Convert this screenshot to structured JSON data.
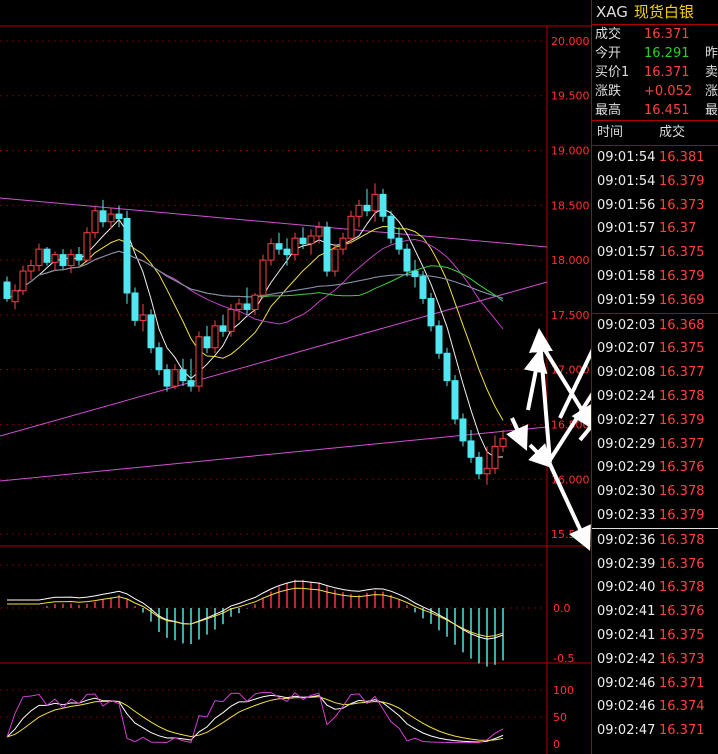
{
  "header": {
    "symbol": "XAG",
    "name": "现货白银"
  },
  "quote": [
    {
      "label": "成交",
      "value": "16.371",
      "color": "red",
      "extra": ""
    },
    {
      "label": "今开",
      "value": "16.291",
      "color": "green",
      "extra": "昨"
    },
    {
      "label": "买价1",
      "value": "16.371",
      "color": "red",
      "extra": "卖"
    },
    {
      "label": "涨跌",
      "value": "+0.052",
      "color": "red",
      "extra": "涨"
    },
    {
      "label": "最高",
      "value": "16.451",
      "color": "red",
      "extra": "最"
    }
  ],
  "ticks_header": {
    "time": "时间",
    "price": "成交"
  },
  "ticks": [
    {
      "time": "09:01:54",
      "price": "16.381"
    },
    {
      "time": "09:01:54",
      "price": "16.379"
    },
    {
      "time": "09:01:56",
      "price": "16.373"
    },
    {
      "time": "09:01:57",
      "price": "16.37"
    },
    {
      "time": "09:01:57",
      "price": "16.375"
    },
    {
      "time": "09:01:58",
      "price": "16.379"
    },
    {
      "time": "09:01:59",
      "price": "16.369"
    },
    {
      "time": "09:02:03",
      "price": "16.368"
    },
    {
      "time": "09:02:07",
      "price": "16.375"
    },
    {
      "time": "09:02:08",
      "price": "16.377"
    },
    {
      "time": "09:02:24",
      "price": "16.378"
    },
    {
      "time": "09:02:27",
      "price": "16.379"
    },
    {
      "time": "09:02:29",
      "price": "16.377"
    },
    {
      "time": "09:02:29",
      "price": "16.376"
    },
    {
      "time": "09:02:30",
      "price": "16.378"
    },
    {
      "time": "09:02:33",
      "price": "16.379"
    },
    {
      "time": "09:02:36",
      "price": "16.378"
    },
    {
      "time": "09:02:39",
      "price": "16.376"
    },
    {
      "time": "09:02:40",
      "price": "16.378"
    },
    {
      "time": "09:02:41",
      "price": "16.376"
    },
    {
      "time": "09:02:41",
      "price": "16.375"
    },
    {
      "time": "09:02:42",
      "price": "16.373"
    },
    {
      "time": "09:02:46",
      "price": "16.371"
    },
    {
      "time": "09:02:46",
      "price": "16.374"
    },
    {
      "time": "09:02:47",
      "price": "16.371"
    }
  ],
  "price_axis": [
    "20.000",
    "19.500",
    "19.000",
    "18.500",
    "18.000",
    "17.500",
    "17.000",
    "16.500",
    "16.000",
    "15.500"
  ],
  "macd_axis": [
    "0.0",
    "-0.5"
  ],
  "kdj_axis": [
    "100",
    "50",
    "0"
  ],
  "chart_data": {
    "type": "candlestick",
    "ylim": [
      15.4,
      20.1
    ],
    "candles": [
      [
        17.8,
        17.85,
        17.62,
        17.65
      ],
      [
        17.62,
        17.78,
        17.55,
        17.72
      ],
      [
        17.72,
        17.95,
        17.68,
        17.9
      ],
      [
        17.9,
        18.0,
        17.82,
        17.95
      ],
      [
        17.95,
        18.15,
        17.9,
        18.1
      ],
      [
        18.1,
        18.12,
        17.95,
        17.98
      ],
      [
        17.98,
        18.08,
        17.9,
        18.05
      ],
      [
        18.05,
        18.1,
        17.92,
        17.95
      ],
      [
        17.95,
        18.1,
        17.88,
        18.05
      ],
      [
        18.05,
        18.12,
        17.95,
        18.0
      ],
      [
        18.0,
        18.3,
        17.98,
        18.25
      ],
      [
        18.25,
        18.5,
        18.2,
        18.45
      ],
      [
        18.45,
        18.55,
        18.3,
        18.35
      ],
      [
        18.35,
        18.48,
        18.28,
        18.42
      ],
      [
        18.42,
        18.5,
        18.3,
        18.38
      ],
      [
        18.38,
        18.45,
        17.6,
        17.7
      ],
      [
        17.7,
        17.75,
        17.4,
        17.45
      ],
      [
        17.45,
        17.6,
        17.35,
        17.5
      ],
      [
        17.5,
        17.55,
        17.15,
        17.2
      ],
      [
        17.2,
        17.25,
        16.95,
        17.0
      ],
      [
        17.0,
        17.05,
        16.8,
        16.85
      ],
      [
        16.85,
        17.05,
        16.82,
        17.0
      ],
      [
        17.0,
        17.1,
        16.85,
        16.9
      ],
      [
        16.9,
        17.1,
        16.8,
        16.85
      ],
      [
        16.85,
        17.35,
        16.8,
        17.3
      ],
      [
        17.3,
        17.4,
        17.15,
        17.2
      ],
      [
        17.2,
        17.45,
        17.15,
        17.4
      ],
      [
        17.4,
        17.5,
        17.3,
        17.35
      ],
      [
        17.35,
        17.6,
        17.3,
        17.55
      ],
      [
        17.55,
        17.65,
        17.45,
        17.6
      ],
      [
        17.6,
        17.75,
        17.5,
        17.55
      ],
      [
        17.55,
        17.7,
        17.5,
        17.68
      ],
      [
        17.68,
        18.05,
        17.65,
        18.0
      ],
      [
        18.0,
        18.2,
        17.95,
        18.15
      ],
      [
        18.15,
        18.25,
        18.05,
        18.1
      ],
      [
        18.1,
        18.2,
        17.95,
        18.05
      ],
      [
        18.05,
        18.25,
        18.0,
        18.2
      ],
      [
        18.2,
        18.3,
        18.1,
        18.15
      ],
      [
        18.15,
        18.28,
        18.05,
        18.22
      ],
      [
        18.22,
        18.35,
        18.15,
        18.3
      ],
      [
        18.3,
        18.35,
        17.85,
        17.9
      ],
      [
        17.9,
        18.15,
        17.85,
        18.1
      ],
      [
        18.1,
        18.25,
        18.05,
        18.2
      ],
      [
        18.2,
        18.45,
        18.15,
        18.4
      ],
      [
        18.4,
        18.55,
        18.3,
        18.5
      ],
      [
        18.5,
        18.65,
        18.4,
        18.45
      ],
      [
        18.45,
        18.7,
        18.35,
        18.6
      ],
      [
        18.6,
        18.65,
        18.35,
        18.4
      ],
      [
        18.4,
        18.45,
        18.15,
        18.2
      ],
      [
        18.2,
        18.3,
        18.05,
        18.1
      ],
      [
        18.1,
        18.15,
        17.85,
        17.9
      ],
      [
        17.9,
        18.0,
        17.75,
        17.85
      ],
      [
        17.85,
        17.9,
        17.6,
        17.65
      ],
      [
        17.65,
        17.7,
        17.35,
        17.4
      ],
      [
        17.4,
        17.45,
        17.1,
        17.15
      ],
      [
        17.15,
        17.2,
        16.85,
        16.9
      ],
      [
        16.9,
        16.95,
        16.5,
        16.55
      ],
      [
        16.55,
        16.6,
        16.3,
        16.35
      ],
      [
        16.35,
        16.45,
        16.15,
        16.2
      ],
      [
        16.2,
        16.25,
        16.0,
        16.05
      ],
      [
        16.05,
        16.3,
        15.95,
        16.1
      ],
      [
        16.1,
        16.4,
        16.05,
        16.3
      ],
      [
        16.3,
        16.45,
        16.25,
        16.37
      ]
    ]
  }
}
